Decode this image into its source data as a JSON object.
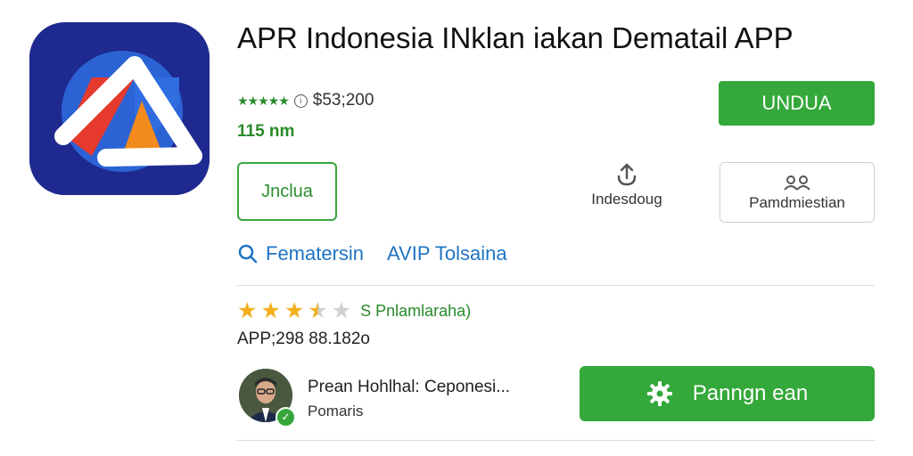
{
  "app": {
    "title": "APR Indonesia INklan iakan Dematail APP",
    "mini_stars": "★★★★★",
    "price": "$53;200",
    "size": "115 nm"
  },
  "actions": {
    "download_label": "UNDUA",
    "install_label": "Jnclua",
    "share_label": "Indesdoug",
    "permission_label": "Pamdmiestian"
  },
  "links": {
    "link1": "Fematersin",
    "link2": "AVIP Tolsaina"
  },
  "reviews": {
    "stars_value": 3.5,
    "badge": "S Pnlamlaraha)",
    "stats": "APP;298 88.182o"
  },
  "developer": {
    "name": "Prean Hohlhal: Ceponesi...",
    "role": "Pomaris"
  },
  "settings": {
    "label": "Panngn ean"
  },
  "colors": {
    "accent_green": "#34a83a",
    "link_blue": "#1f74c4",
    "star_gold": "#f2b01e",
    "icon_bg": "#1e2a8f"
  }
}
